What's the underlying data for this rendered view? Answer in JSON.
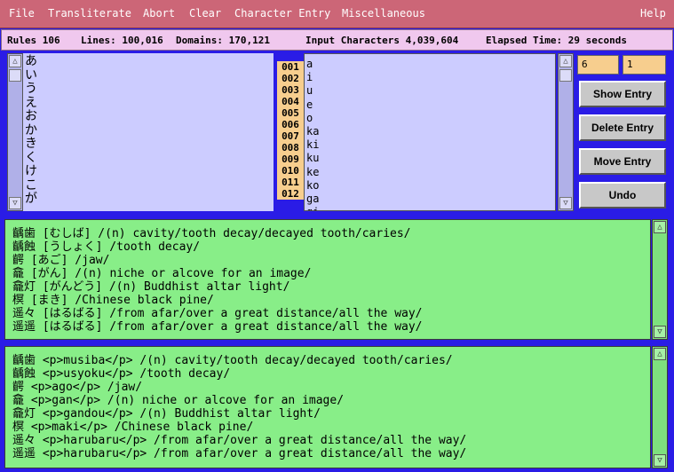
{
  "menu": [
    "File",
    "Transliterate",
    "Abort",
    "Clear",
    "Character Entry",
    "Miscellaneous",
    "Help"
  ],
  "status": {
    "rules": "Rules 106",
    "lines": "Lines: 100,016",
    "domains": "Domains: 170,121",
    "input": "Input Characters 4,039,604",
    "elapsed": "Elapsed Time: 29 seconds"
  },
  "kana_column": [
    "あ",
    "い",
    "う",
    "え",
    "お",
    "か",
    "き",
    "く",
    "け",
    "こ",
    "が",
    "ぎ"
  ],
  "numbers": [
    "001",
    "002",
    "003",
    "004",
    "005",
    "006",
    "007",
    "008",
    "009",
    "010",
    "011",
    "012"
  ],
  "romaji": [
    "a",
    "i",
    "u",
    "e",
    "o",
    "ka",
    "ki",
    "ku",
    "ke",
    "ko",
    "ga",
    "gi"
  ],
  "fields": {
    "left": "6",
    "right": "1"
  },
  "buttons": [
    "Show Entry",
    "Delete Entry",
    "Move Entry",
    "Undo"
  ],
  "dict_lines": [
    "齲歯 [むしば] /(n) cavity/tooth decay/decayed tooth/caries/",
    "齲蝕 [うしょく] /tooth decay/",
    "齶 [あご] /jaw/",
    "龕 [がん] /(n) niche or alcove for an image/",
    "龕灯 [がんどう] /(n) Buddhist altar light/",
    "榠 [まき] /Chinese black pine/",
    "遥々 [はるばる] /from afar/over a great distance/all the way/",
    "遥遥 [はるばる] /from afar/over a great distance/all the way/"
  ],
  "output_lines": [
    "齲歯 <p>musiba</p> /(n) cavity/tooth decay/decayed tooth/caries/",
    "齲蝕 <p>usyoku</p> /tooth decay/",
    "齶 <p>ago</p> /jaw/",
    "龕 <p>gan</p> /(n) niche or alcove for an image/",
    "龕灯 <p>gandou</p> /(n) Buddhist altar light/",
    "榠 <p>maki</p> /Chinese black pine/",
    "遥々 <p>harubaru</p> /from afar/over a great distance/all the way/",
    "遥遥 <p>harubaru</p> /from afar/over a great distance/all the way/"
  ]
}
